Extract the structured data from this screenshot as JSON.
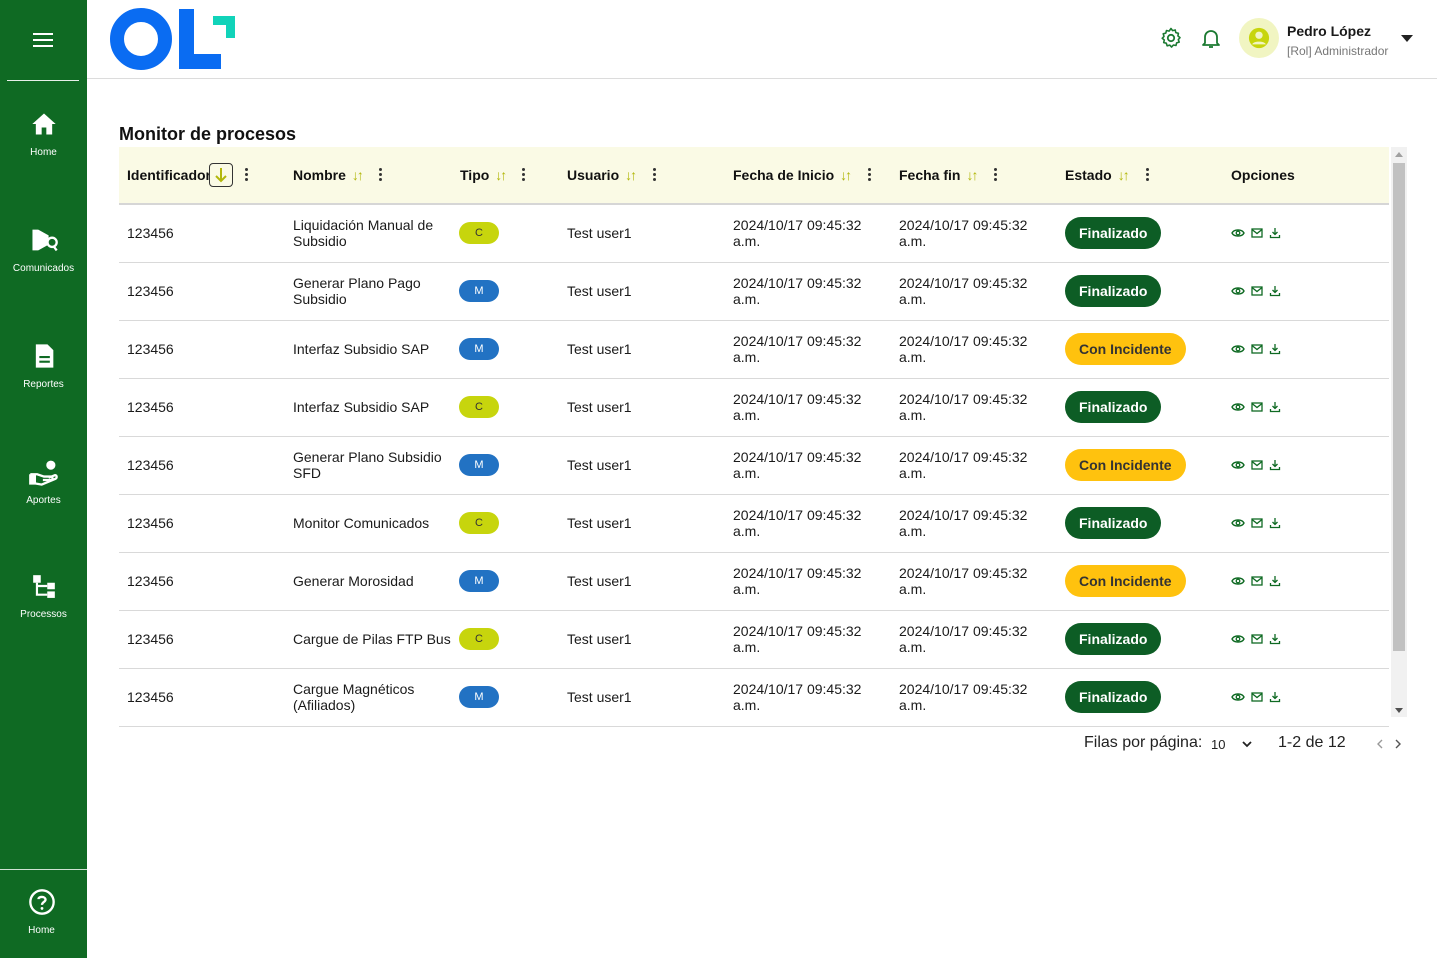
{
  "sidebar": {
    "items": [
      {
        "label": "Home",
        "icon": "home-icon"
      },
      {
        "label": "Comunicados",
        "icon": "megaphone-icon"
      },
      {
        "label": "Reportes",
        "icon": "document-icon"
      },
      {
        "label": "Aportes",
        "icon": "hand-coin-icon"
      },
      {
        "label": "Processos",
        "icon": "hierarchy-icon"
      }
    ],
    "bottom": {
      "label": "Home",
      "icon": "help-icon"
    }
  },
  "header": {
    "logo_text": "OL",
    "user_name": "Pedro López",
    "user_role": "[Rol] Administrador"
  },
  "page": {
    "title": "Monitor de procesos"
  },
  "table": {
    "columns": {
      "id": "Identificador",
      "nombre": "Nombre",
      "tipo": "Tipo",
      "usuario": "Usuario",
      "inicio": "Fecha de Inicio",
      "fin": "Fecha fin",
      "estado": "Estado",
      "opciones": "Opciones"
    },
    "rows": [
      {
        "id": "123456",
        "nombre": "Liquidación Manual de Subsidio",
        "tipo": "C",
        "usuario": "Test user1",
        "inicio": "2024/10/17 09:45:32 a.m.",
        "fin": "2024/10/17 09:45:32 a.m.",
        "estado": "Finalizado"
      },
      {
        "id": "123456",
        "nombre": "Generar Plano Pago Subsidio",
        "tipo": "M",
        "usuario": "Test user1",
        "inicio": "2024/10/17 09:45:32 a.m.",
        "fin": "2024/10/17 09:45:32 a.m.",
        "estado": "Finalizado"
      },
      {
        "id": "123456",
        "nombre": "Interfaz Subsidio SAP",
        "tipo": "M",
        "usuario": "Test user1",
        "inicio": "2024/10/17 09:45:32 a.m.",
        "fin": "2024/10/17 09:45:32 a.m.",
        "estado": "Con Incidente"
      },
      {
        "id": "123456",
        "nombre": "Interfaz Subsidio SAP",
        "tipo": "C",
        "usuario": "Test user1",
        "inicio": "2024/10/17 09:45:32 a.m.",
        "fin": "2024/10/17 09:45:32 a.m.",
        "estado": "Finalizado"
      },
      {
        "id": "123456",
        "nombre": "Generar Plano Subsidio SFD",
        "tipo": "M",
        "usuario": "Test user1",
        "inicio": "2024/10/17 09:45:32 a.m.",
        "fin": "2024/10/17 09:45:32 a.m.",
        "estado": "Con Incidente"
      },
      {
        "id": "123456",
        "nombre": "Monitor Comunicados",
        "tipo": "C",
        "usuario": "Test user1",
        "inicio": "2024/10/17 09:45:32 a.m.",
        "fin": "2024/10/17 09:45:32 a.m.",
        "estado": "Finalizado"
      },
      {
        "id": "123456",
        "nombre": "Generar Morosidad",
        "tipo": "M",
        "usuario": "Test user1",
        "inicio": "2024/10/17 09:45:32 a.m.",
        "fin": "2024/10/17 09:45:32 a.m.",
        "estado": "Con Incidente"
      },
      {
        "id": "123456",
        "nombre": "Cargue de Pilas FTP Bus",
        "tipo": "C",
        "usuario": "Test user1",
        "inicio": "2024/10/17 09:45:32 a.m.",
        "fin": "2024/10/17 09:45:32 a.m.",
        "estado": "Finalizado"
      },
      {
        "id": "123456",
        "nombre": "Cargue Magnéticos (Afiliados)",
        "tipo": "M",
        "usuario": "Test user1",
        "inicio": "2024/10/17 09:45:32 a.m.",
        "fin": "2024/10/17 09:45:32 a.m.",
        "estado": "Finalizado"
      }
    ]
  },
  "pagination": {
    "rows_label": "Filas por página:",
    "rows_value": "10",
    "range": "1-2 de 12"
  },
  "colors": {
    "sidebar": "#0f6a23",
    "tipo_c": "#c7d50d",
    "tipo_m": "#2272c3",
    "finalizado": "#0d5d25",
    "incidente": "#ffc20e",
    "logo_blue": "#0a6cf2",
    "logo_teal": "#11d3b9"
  }
}
